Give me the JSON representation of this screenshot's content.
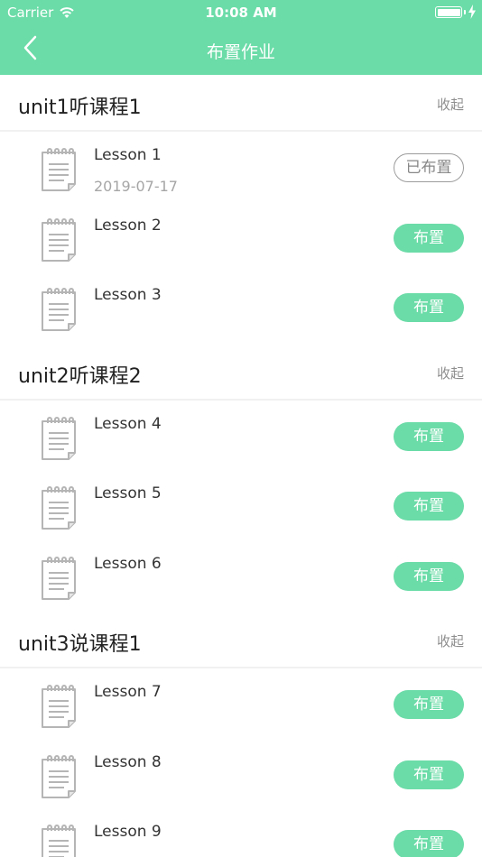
{
  "status_bar": {
    "carrier": "Carrier",
    "time": "10:08 AM",
    "battery_level": 1.0
  },
  "nav": {
    "title": "布置作业",
    "back_icon": "chevron-left-icon"
  },
  "colors": {
    "accent": "#6bdba7",
    "muted_text": "#8e8e8e",
    "assigned_border": "#9c9c9c"
  },
  "sections": [
    {
      "title": "unit1听课程1",
      "collapse_label": "收起",
      "lessons": [
        {
          "name": "Lesson 1",
          "date": "2019-07-17",
          "action": "已布置",
          "assigned": true
        },
        {
          "name": "Lesson 2",
          "date": "",
          "action": "布置",
          "assigned": false
        },
        {
          "name": "Lesson 3",
          "date": "",
          "action": "布置",
          "assigned": false
        }
      ]
    },
    {
      "title": "unit2听课程2",
      "collapse_label": "收起",
      "lessons": [
        {
          "name": "Lesson 4",
          "date": "",
          "action": "布置",
          "assigned": false
        },
        {
          "name": "Lesson 5",
          "date": "",
          "action": "布置",
          "assigned": false
        },
        {
          "name": "Lesson 6",
          "date": "",
          "action": "布置",
          "assigned": false
        }
      ]
    },
    {
      "title": "unit3说课程1",
      "collapse_label": "收起",
      "lessons": [
        {
          "name": "Lesson 7",
          "date": "",
          "action": "布置",
          "assigned": false
        },
        {
          "name": "Lesson 8",
          "date": "",
          "action": "布置",
          "assigned": false
        },
        {
          "name": "Lesson 9",
          "date": "",
          "action": "布置",
          "assigned": false
        }
      ]
    }
  ]
}
